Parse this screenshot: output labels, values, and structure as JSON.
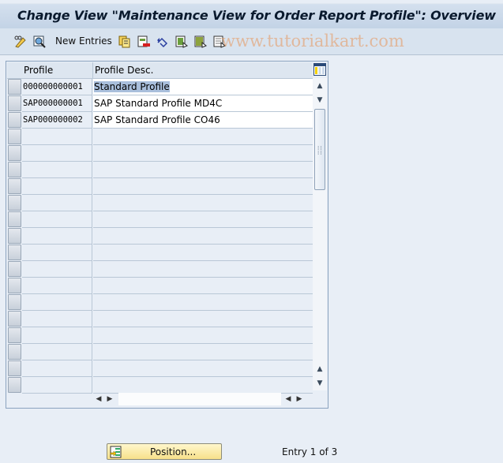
{
  "window": {
    "title": "Change View \"Maintenance View for Order Report Profile\": Overview"
  },
  "toolbar": {
    "items": [
      {
        "icon": "pencil-glasses-icon",
        "label": ""
      },
      {
        "icon": "display-details-icon",
        "label": ""
      },
      {
        "icon": "",
        "label": "New Entries"
      },
      {
        "icon": "copy-icon",
        "label": ""
      },
      {
        "icon": "delete-icon",
        "label": ""
      },
      {
        "icon": "undo-change-icon",
        "label": ""
      },
      {
        "icon": "select-all-icon",
        "label": ""
      },
      {
        "icon": "select-block-icon",
        "label": ""
      },
      {
        "icon": "deselect-all-icon",
        "label": ""
      }
    ],
    "new_entries_label": "New Entries",
    "watermark": "www.tutorialkart.com"
  },
  "table": {
    "columns": [
      "Profile",
      "Profile Desc."
    ],
    "rows": [
      {
        "profile": "000000000001",
        "desc": "Standard Profile",
        "selected_text": true
      },
      {
        "profile": "SAP000000001",
        "desc": "SAP Standard Profile MD4C"
      },
      {
        "profile": "SAP000000002",
        "desc": "SAP Standard Profile CO46"
      }
    ],
    "empty_rows": 16
  },
  "footer": {
    "position_button": "Position...",
    "entry_status": "Entry 1 of 3"
  }
}
